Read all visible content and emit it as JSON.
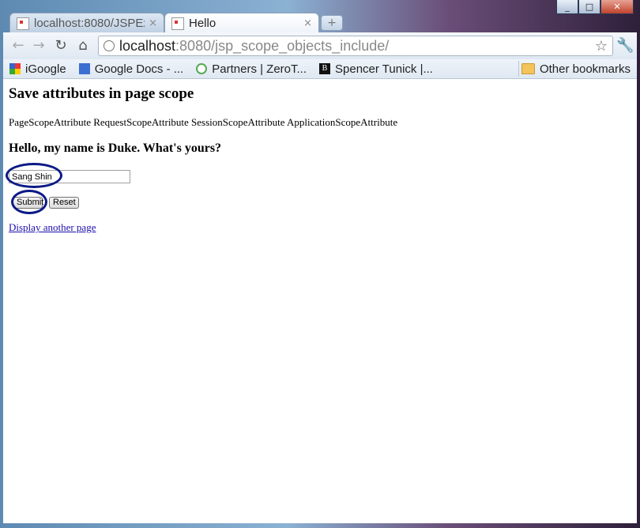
{
  "browser": {
    "tabs": [
      {
        "title": "localhost:8080/JSPExa",
        "close": "×"
      },
      {
        "title": "Hello",
        "close": "×"
      }
    ],
    "new_tab": "+",
    "window_controls": {
      "minimize": "_",
      "maximize": "□",
      "close": "✕"
    },
    "nav": {
      "back": "←",
      "forward": "→",
      "reload": "↻",
      "home": "⌂",
      "star": "☆",
      "wrench": "🔧"
    },
    "url_host": "localhost",
    "url_rest": ":8080/jsp_scope_objects_include/",
    "bookmarks": [
      {
        "label": "iGoogle",
        "icon": "igoogle-icon"
      },
      {
        "label": "Google Docs - ...",
        "icon": "google-docs-icon"
      },
      {
        "label": "Partners | ZeroT...",
        "icon": "partners-icon"
      },
      {
        "label": "Spencer Tunick |...",
        "icon": "spencer-tunick-icon"
      }
    ],
    "other_bookmarks": "Other bookmarks"
  },
  "page": {
    "heading": "Save attributes in page scope",
    "scopes": "PageScopeAttribute RequestScopeAttribute SessionScopeAttribute ApplicationScopeAttribute",
    "greeting": "Hello, my name is Duke. What's yours?",
    "name_value": "Sang Shin",
    "submit_label": "Submit",
    "reset_label": "Reset",
    "link_text": "Display another page"
  },
  "colors": {
    "annotation": "#0c1a86",
    "link": "#1a0dab"
  }
}
